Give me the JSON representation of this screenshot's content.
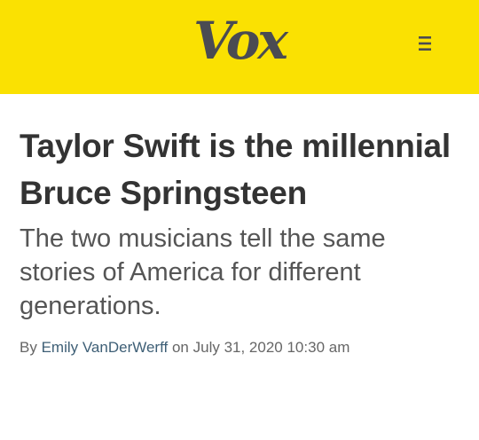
{
  "header": {
    "logo_text": "Vox",
    "menu_icon": "hamburger-menu-icon",
    "background_color": "#fae102"
  },
  "article": {
    "headline": "Taylor Swift is the millennial Bruce Springsteen",
    "dek": "The two musicians tell the same stories of America for different generations.",
    "byline": {
      "prefix": "By",
      "author": "Emily VanDerWerff",
      "on_text": "on",
      "date": "July 31, 2020 10:30 am"
    }
  }
}
